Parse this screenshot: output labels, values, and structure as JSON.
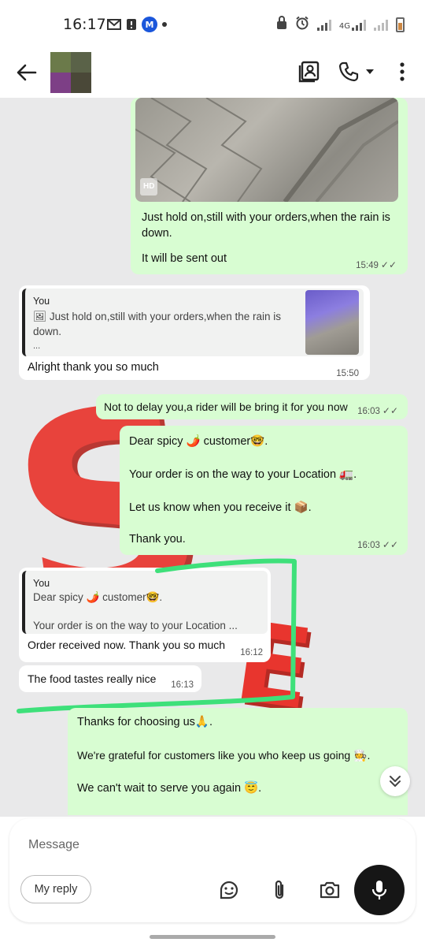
{
  "status_bar": {
    "time": "16:17",
    "m_badge": "M",
    "network": "4G",
    "icons": [
      "gmail-icon",
      "message-icon",
      "messenger-badge",
      "dot",
      "lock-icon",
      "alarm-icon",
      "signal-icon",
      "signal-4g-icon",
      "signal-icon",
      "battery-icon"
    ]
  },
  "header": {
    "back_icon": "arrow-left-icon",
    "icons": [
      "contact-card-icon",
      "call-icon",
      "dropdown-icon",
      "more-vertical-icon"
    ]
  },
  "messages": [
    {
      "id": "m1",
      "direction": "outgoing",
      "has_image": true,
      "image_badge": "HD",
      "lines": [
        "Just hold on,still with your orders,when the rain is down.",
        "It will be sent out"
      ],
      "time": "15:49",
      "ticks": "✓✓"
    },
    {
      "id": "m2",
      "direction": "incoming",
      "quote_author": "You",
      "quote_text": "🖼 Just hold on,still with your orders,when the rain is down.",
      "quote_ellipsis": "...",
      "text": "Alright thank you so much",
      "time": "15:50"
    },
    {
      "id": "m3",
      "direction": "outgoing",
      "text": "Not to delay you,a rider will be bring it for you now",
      "time": "16:03",
      "ticks": "✓✓"
    },
    {
      "id": "m4",
      "direction": "outgoing",
      "lines": [
        "Dear spicy 🌶️ customer🤓.",
        "Your order is on the way to your Location 🚛.",
        "Let us know when you receive it 📦.",
        "Thank you."
      ],
      "time": "16:03",
      "ticks": "✓✓"
    },
    {
      "id": "m5",
      "direction": "incoming",
      "quote_author": "You",
      "quote_line1": "Dear spicy 🌶️ customer🤓.",
      "quote_line2": "Your order is on the way to your Location ...",
      "text": "Order received now. Thank you so much",
      "time": "16:12"
    },
    {
      "id": "m6",
      "direction": "incoming",
      "text": "The food tastes really nice",
      "time": "16:13"
    },
    {
      "id": "m7",
      "direction": "outgoing",
      "lines": [
        "Thanks for choosing us🙏.",
        "We're grateful for customers like you who keep us going 🧑‍🍳.",
        "We can't wait to serve you again 😇."
      ]
    }
  ],
  "scroll_down_icon": "chevrons-down-icon",
  "composer": {
    "placeholder": "Message",
    "my_reply_label": "My reply",
    "icons": [
      "sticker-icon",
      "attach-icon",
      "camera-icon",
      "mic-icon"
    ]
  },
  "colors": {
    "outgoing_bubble": "#d8fdd2",
    "incoming_bubble": "#ffffff",
    "highlight_marker": "#3ee07a",
    "mic_button": "#161616"
  }
}
